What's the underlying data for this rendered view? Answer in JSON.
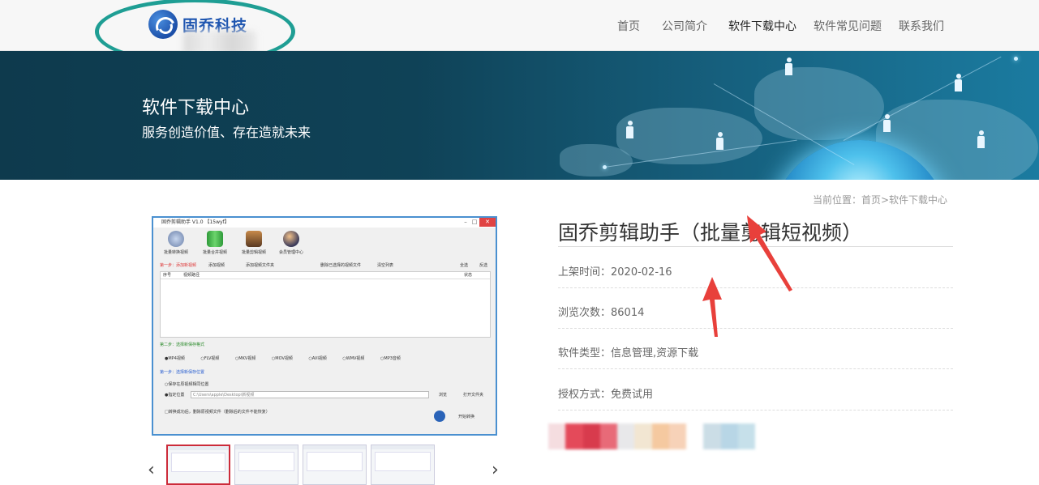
{
  "header": {
    "logo_text": "固乔科技",
    "nav": [
      {
        "label": "首页",
        "active": false
      },
      {
        "label": "公司简介",
        "active": false
      },
      {
        "label": "软件下载中心",
        "active": true
      },
      {
        "label": "软件常见问题",
        "active": false
      },
      {
        "label": "联系我们",
        "active": false
      }
    ]
  },
  "banner": {
    "title": "软件下载中心",
    "subtitle": "服务创造价值、存在造就未来"
  },
  "breadcrumb": "当前位置：首页>软件下载中心",
  "screenshot": {
    "window_title": "固乔剪辑助手 V1.0 【15wyf】",
    "toolbar": [
      "批量转换视频",
      "批量合并视频",
      "批量剪辑视频",
      "会员管理中心"
    ],
    "step1": "第一步：添加新视频",
    "step1_actions": [
      "添加视频",
      "添加视频文件夹",
      "删除已选择的视频文件",
      "清空列表",
      "全选",
      "反选"
    ],
    "columns": [
      "序号",
      "视频路径",
      "状态"
    ],
    "step2": "第二步：选择新保存格式",
    "formats": "●MP4视频 ○FLV视频 ○MKV视频 ○MOV视频 ○AVI视频 ○WMV视频 ○MP3音频",
    "step3": "第一步：选择新保存位置",
    "save_opt1": "○保存在原视频相同位置",
    "save_opt2": "●指定位置",
    "path": "C:\\Users\\apple\\Desktop\\新视频",
    "browse": "浏览",
    "open_folder": "打开文件夹",
    "delete_opt": "□转换成功后，删除原视频文件（删除后的文件不能恢复）",
    "start": "开始转换"
  },
  "gallery": {
    "prev": "‹",
    "next": "›"
  },
  "product": {
    "title": "固乔剪辑助手（批量剪辑短视频）",
    "release": "上架时间：2020-02-16",
    "views": "浏览次数：86014",
    "category": "软件类型：信息管理,资源下载",
    "license": "授权方式：免费试用"
  },
  "colors": {
    "banner_bg": "#0f4257",
    "logo_blue": "#1e55b0",
    "ellipse": "#1f9e94",
    "annotation_red": "#e8403b"
  }
}
